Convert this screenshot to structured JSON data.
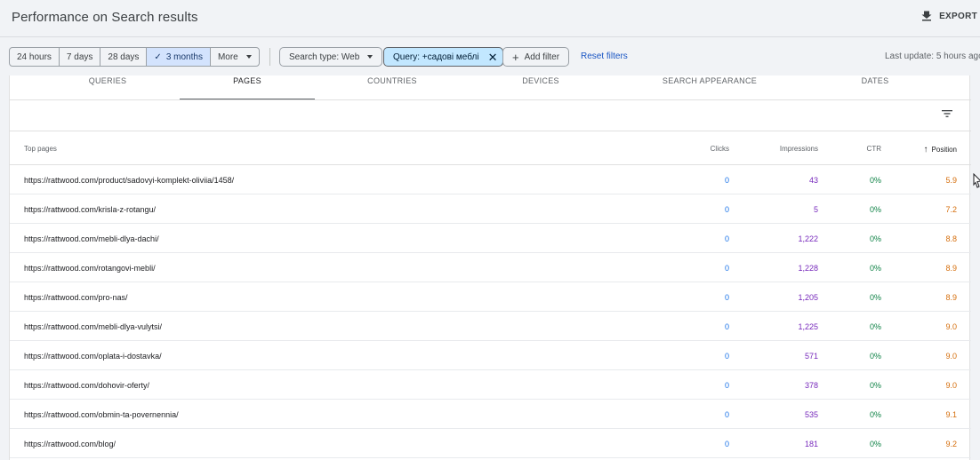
{
  "header": {
    "title": "Performance on Search results",
    "export_label": "EXPORT"
  },
  "filters": {
    "date_ranges": [
      {
        "label": "24 hours",
        "active": false
      },
      {
        "label": "7 days",
        "active": false
      },
      {
        "label": "28 days",
        "active": false
      },
      {
        "label": "3 months",
        "active": true
      }
    ],
    "more_label": "More",
    "search_type": "Search type: Web",
    "query_chip": "Query: +садові меблі",
    "add_filter": "Add filter",
    "reset": "Reset filters",
    "last_update": "Last update: 5 hours ago"
  },
  "tabs": [
    {
      "label": "QUERIES",
      "active": false
    },
    {
      "label": "PAGES",
      "active": true
    },
    {
      "label": "COUNTRIES",
      "active": false
    },
    {
      "label": "DEVICES",
      "active": false
    },
    {
      "label": "SEARCH APPEARANCE",
      "active": false
    },
    {
      "label": "DATES",
      "active": false
    }
  ],
  "table": {
    "headers": {
      "page": "Top pages",
      "clicks": "Clicks",
      "impressions": "Impressions",
      "ctr": "CTR",
      "position": "Position"
    },
    "sort": {
      "column": "position",
      "direction": "ascending"
    },
    "rows": [
      {
        "url": "https://rattwood.com/product/sadovyi-komplekt-oliviia/1458/",
        "clicks": "0",
        "impressions": "43",
        "ctr": "0%",
        "position": "5.9"
      },
      {
        "url": "https://rattwood.com/krisla-z-rotangu/",
        "clicks": "0",
        "impressions": "5",
        "ctr": "0%",
        "position": "7.2"
      },
      {
        "url": "https://rattwood.com/mebli-dlya-dachi/",
        "clicks": "0",
        "impressions": "1,222",
        "ctr": "0%",
        "position": "8.8"
      },
      {
        "url": "https://rattwood.com/rotangovi-mebli/",
        "clicks": "0",
        "impressions": "1,228",
        "ctr": "0%",
        "position": "8.9"
      },
      {
        "url": "https://rattwood.com/pro-nas/",
        "clicks": "0",
        "impressions": "1,205",
        "ctr": "0%",
        "position": "8.9"
      },
      {
        "url": "https://rattwood.com/mebli-dlya-vulytsi/",
        "clicks": "0",
        "impressions": "1,225",
        "ctr": "0%",
        "position": "9.0"
      },
      {
        "url": "https://rattwood.com/oplata-i-dostavka/",
        "clicks": "0",
        "impressions": "571",
        "ctr": "0%",
        "position": "9.0"
      },
      {
        "url": "https://rattwood.com/dohovir-oferty/",
        "clicks": "0",
        "impressions": "378",
        "ctr": "0%",
        "position": "9.0"
      },
      {
        "url": "https://rattwood.com/obmin-ta-povernennia/",
        "clicks": "0",
        "impressions": "535",
        "ctr": "0%",
        "position": "9.1"
      },
      {
        "url": "https://rattwood.com/blog/",
        "clicks": "0",
        "impressions": "181",
        "ctr": "0%",
        "position": "9.2"
      }
    ]
  },
  "colors": {
    "clicks": "#1a73e8",
    "impressions": "#7627bb",
    "ctr": "#0b8043",
    "position": "#d56e0c",
    "active_chip": "#c2e7ff",
    "link": "#1a56c4"
  },
  "icons": {
    "export": "download-icon",
    "filter": "filter-list-icon",
    "sort": "arrow-up-icon",
    "check": "check-icon",
    "close": "close-icon",
    "add": "add-icon"
  }
}
